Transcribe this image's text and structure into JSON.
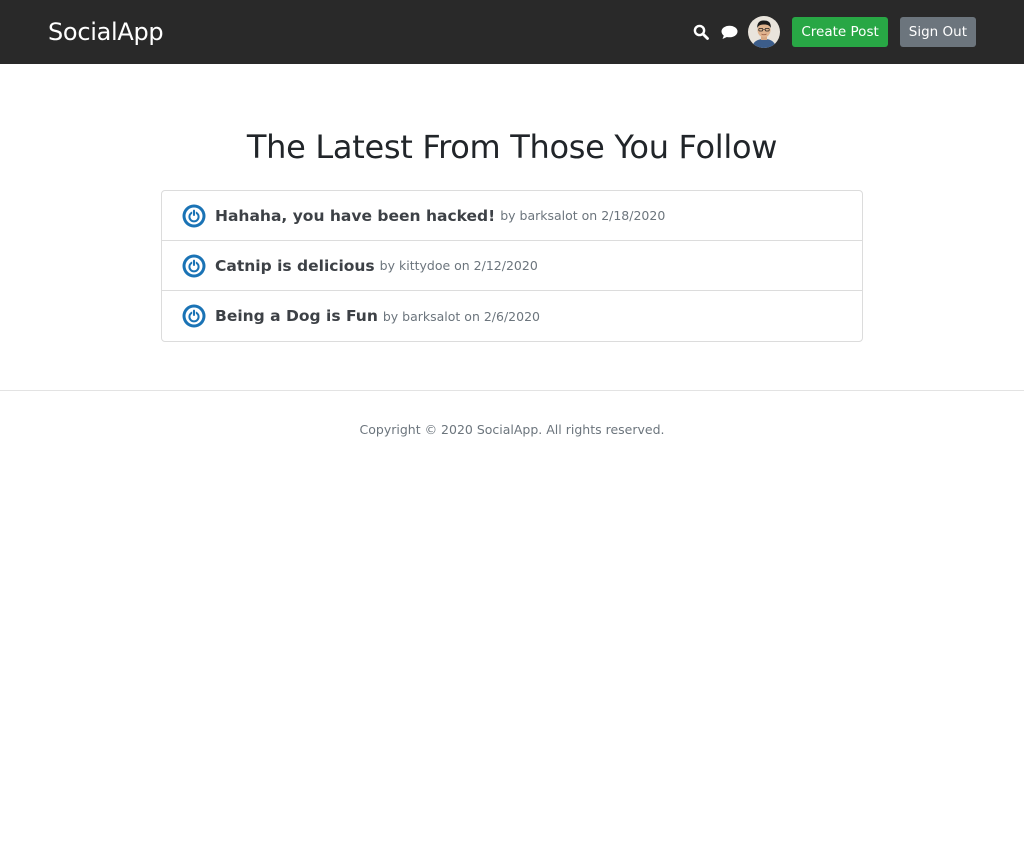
{
  "header": {
    "brand": "SocialApp",
    "icons": [
      "search-icon",
      "chat-icon"
    ],
    "create_post_label": "Create Post",
    "sign_out_label": "Sign Out",
    "colors": {
      "navbar_bg": "#292929",
      "create_post": "#28a745",
      "sign_out": "#6c757d"
    }
  },
  "main": {
    "title": "The Latest From Those You Follow",
    "posts": [
      {
        "title": "Hahaha, you have been hacked!",
        "meta": "by barksalot on 2/18/2020"
      },
      {
        "title": "Catnip is delicious",
        "meta": "by kittydoe on 2/12/2020"
      },
      {
        "title": "Being a Dog is Fun",
        "meta": "by barksalot on 2/6/2020"
      }
    ],
    "post_avatar_icon": "power-icon",
    "post_avatar_color": "#1a73b5"
  },
  "footer": {
    "copyright": "Copyright © 2020 SocialApp. All rights reserved."
  }
}
